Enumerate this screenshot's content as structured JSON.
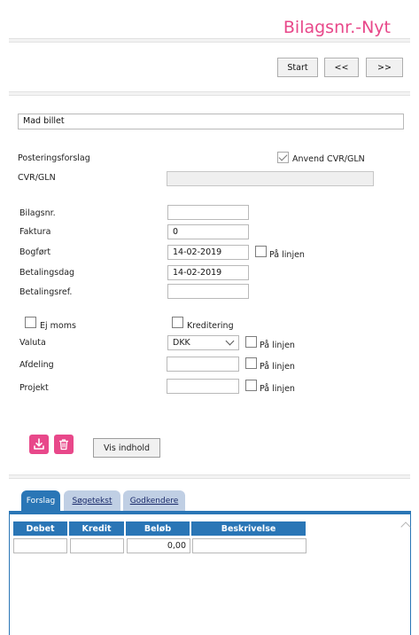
{
  "header": {
    "title": "Bilagsnr.-Nyt"
  },
  "nav": {
    "start": "Start",
    "prev": "<<",
    "next": ">>"
  },
  "description_value": "Mad billet",
  "posting": {
    "label": "Posteringsforslag",
    "apply_cvr_label": "Anvend CVR/GLN",
    "apply_cvr_checked": true,
    "cvr_label": "CVR/GLN",
    "cvr_value": ""
  },
  "form": {
    "bilagsnr_label": "Bilagsnr.",
    "bilagsnr_value": "",
    "faktura_label": "Faktura",
    "faktura_value": "0",
    "bogfort_label": "Bogført",
    "bogfort_value": "14-02-2019",
    "bogfort_paa_linjen": "På linjen",
    "betalingsdag_label": "Betalingsdag",
    "betalingsdag_value": "14-02-2019",
    "betalingsref_label": "Betalingsref.",
    "betalingsref_value": "",
    "ej_moms_label": "Ej moms",
    "kreditering_label": "Kreditering",
    "valuta_label": "Valuta",
    "valuta_value": "DKK",
    "valuta_paa_linjen": "På linjen",
    "afdeling_label": "Afdeling",
    "afdeling_value": "",
    "afdeling_paa_linjen": "På linjen",
    "projekt_label": "Projekt",
    "projekt_value": "",
    "projekt_paa_linjen": "På linjen"
  },
  "actions": {
    "download_icon": "download-icon",
    "trash_icon": "trash-icon",
    "vis_indhold": "Vis indhold",
    "accent": "#e8488a"
  },
  "tabs": [
    {
      "label": "Forslag",
      "active": true
    },
    {
      "label": "Søgetekst",
      "active": false
    },
    {
      "label": "Godkendere",
      "active": false
    }
  ],
  "grid": {
    "columns": [
      "Debet",
      "Kredit",
      "Beløb",
      "Beskrivelse"
    ],
    "row": [
      "",
      "",
      "0,00",
      ""
    ],
    "header_color": "#2a76b6"
  }
}
